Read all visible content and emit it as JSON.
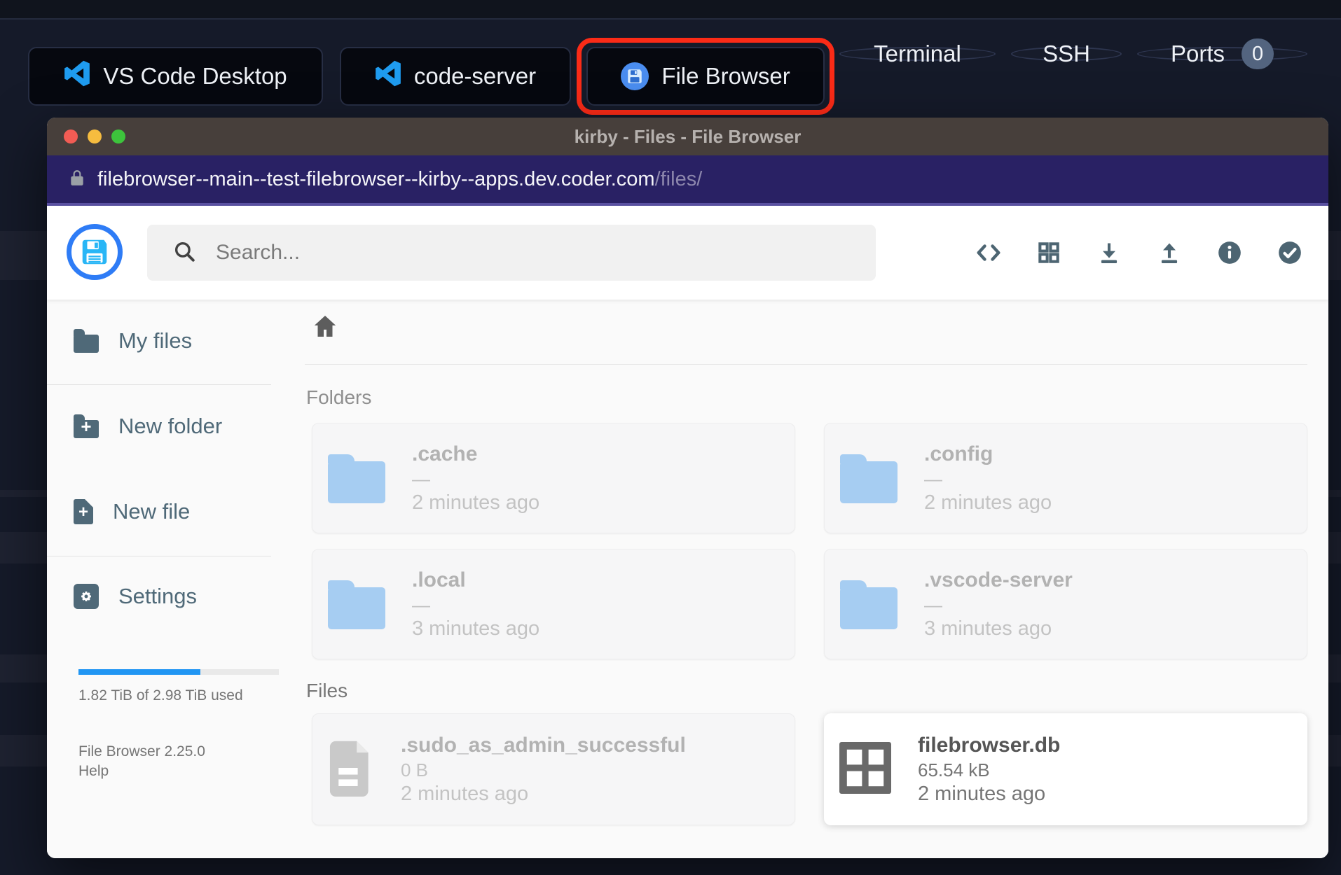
{
  "colors": {
    "accent_blue": "#2196f3",
    "highlight_red": "#fb2b17",
    "slate_icon": "#4d6572",
    "folder_blue": "#a6cdf2",
    "urlbar_purple": "#292164"
  },
  "taskbar": {
    "buttons": [
      {
        "label": "VS Code Desktop",
        "icon": "vscode-icon"
      },
      {
        "label": "code-server",
        "icon": "vscode-icon"
      },
      {
        "label": "File Browser",
        "icon": "filebrowser-icon",
        "highlighted": true
      },
      {
        "label": "Terminal"
      },
      {
        "label": "SSH"
      },
      {
        "label": "Ports",
        "badge": "0"
      }
    ]
  },
  "window": {
    "title": "kirby - Files - File Browser",
    "url": {
      "host": "filebrowser--main--test-filebrowser--kirby--apps.dev.coder.com",
      "path": "/files/"
    }
  },
  "header": {
    "search_placeholder": "Search...",
    "icons": [
      "code-icon",
      "grid-icon",
      "download-icon",
      "upload-icon",
      "info-icon",
      "check-circle-icon"
    ]
  },
  "sidebar": {
    "items": [
      {
        "label": "My files",
        "icon": "folder-icon"
      },
      {
        "label": "New folder",
        "icon": "folder-plus-icon"
      },
      {
        "label": "New file",
        "icon": "file-plus-icon"
      },
      {
        "label": "Settings",
        "icon": "gear-icon"
      }
    ],
    "usage": {
      "text": "1.82 TiB of 2.98 TiB used",
      "percent": 61
    },
    "version": "File Browser 2.25.0",
    "help": "Help"
  },
  "main": {
    "folders_label": "Folders",
    "files_label": "Files",
    "folders": [
      {
        "name": ".cache",
        "size": "—",
        "modified": "2 minutes ago"
      },
      {
        "name": ".config",
        "size": "—",
        "modified": "2 minutes ago"
      },
      {
        "name": ".local",
        "size": "—",
        "modified": "3 minutes ago"
      },
      {
        "name": ".vscode-server",
        "size": "—",
        "modified": "3 minutes ago"
      }
    ],
    "files": [
      {
        "name": ".sudo_as_admin_successful",
        "size": "0 B",
        "modified": "2 minutes ago"
      },
      {
        "name": "filebrowser.db",
        "size": "65.54 kB",
        "modified": "2 minutes ago"
      }
    ]
  }
}
